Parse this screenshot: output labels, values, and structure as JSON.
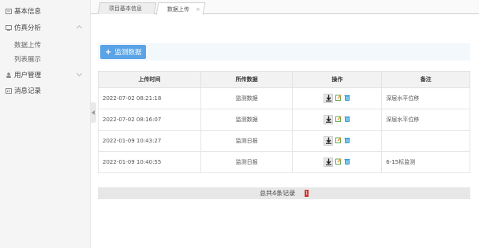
{
  "sidebar": {
    "items": [
      {
        "label": "基本信息"
      },
      {
        "label": "仿真分析"
      },
      {
        "label": "用户管理"
      },
      {
        "label": "消息记录"
      }
    ],
    "sub_items": [
      {
        "label": "数据上传"
      },
      {
        "label": "列表展示"
      }
    ]
  },
  "tabs": [
    {
      "label": "项目基本信息"
    },
    {
      "label": "数据上传",
      "close": "×"
    }
  ],
  "toolbar": {
    "add_label": "监测数据",
    "plus": "+"
  },
  "table": {
    "headers": [
      "上传时间",
      "所传数据",
      "操作",
      "备注"
    ],
    "rows": [
      {
        "time": "2022-07-02 08:21:18",
        "data": "监测数据",
        "note": "深层水平位移"
      },
      {
        "time": "2022-07-02 08:16:07",
        "data": "监测数据",
        "note": "深层水平位移"
      },
      {
        "time": "2022-01-09 10:43:27",
        "data": "监测日报",
        "note": ""
      },
      {
        "time": "2022-01-09 10:40:55",
        "data": "监测日报",
        "note": "6-15标监测"
      }
    ]
  },
  "footer": {
    "total": "总共4条记录",
    "page": "1"
  },
  "colors": {
    "accent": "#5aa3e6",
    "page_badge": "#d0312d"
  }
}
